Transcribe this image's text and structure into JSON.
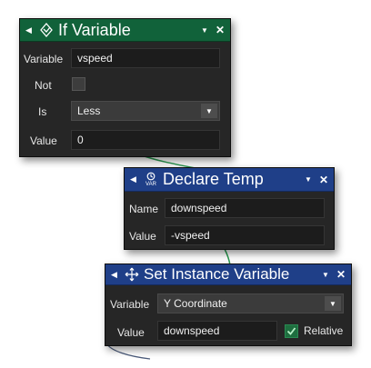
{
  "if_variable": {
    "title": "If Variable",
    "variable_label": "Variable",
    "variable_value": "vspeed",
    "not_label": "Not",
    "not_checked": false,
    "is_label": "Is",
    "is_value": "Less",
    "value_label": "Value",
    "value_value": "0"
  },
  "declare_temp": {
    "title": "Declare Temp",
    "icon_text": "VAR",
    "name_label": "Name",
    "name_value": "downspeed",
    "value_label": "Value",
    "value_value": "-vspeed"
  },
  "set_instance_variable": {
    "title": "Set Instance Variable",
    "variable_label": "Variable",
    "variable_value": "Y Coordinate",
    "value_label": "Value",
    "value_value": "downspeed",
    "relative_label": "Relative",
    "relative_checked": true
  },
  "colors": {
    "header_green": "#11623a",
    "header_blue": "#1f3f88",
    "panel": "#262626",
    "connector": "#2a9a50"
  }
}
